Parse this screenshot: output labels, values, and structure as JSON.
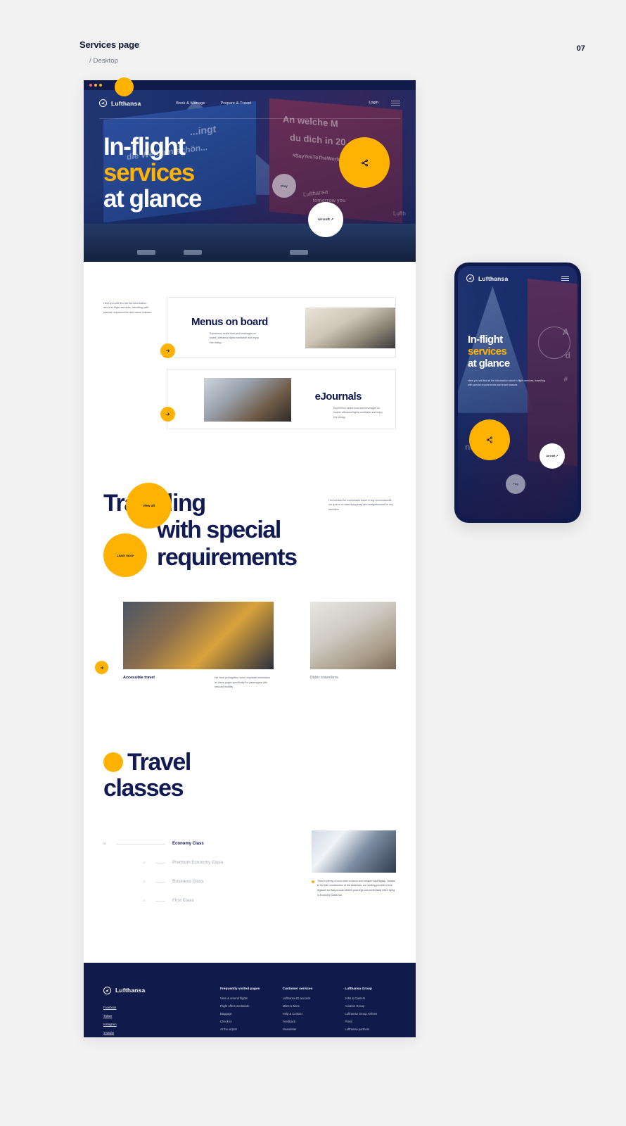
{
  "caption": {
    "title": "Services page",
    "subtitle": "/ Desktop",
    "page_number": "07"
  },
  "colors": {
    "navy": "#101a4b",
    "deep_navy": "#111a52",
    "amber": "#ffb300",
    "page_bg": "#f2f2f2"
  },
  "desktop": {
    "nav": {
      "brand": "Lufthansa",
      "links": [
        "Book & Manage",
        "Prepare & Travel"
      ],
      "login": "Login",
      "menu_icon": "hamburger-icon"
    },
    "hero": {
      "title_line1": "In-flight",
      "title_line2": "services",
      "title_line3": "at glance",
      "share_icon": "share-icon",
      "play_label": "Play",
      "aircraft_label": "Aircraft ↗",
      "billboard_text": {
        "line1": "...ingt",
        "line2": "die Welt am schön...",
        "line3": "An welche M",
        "line4": "du dich in 20",
        "hashtag": "#SayYesToTheWorld",
        "tomorrow": "tomorrow you",
        "brand1": "Lufthansa",
        "brand2": "Lufth"
      }
    },
    "services": {
      "intro": "Here you will find all the information about in-flight services, travelling with special requirements and travel classes.",
      "view_all": "View all",
      "cards": [
        {
          "title": "Menus on board",
          "description": "Experience select food and beverages on board Lufthansa flights worldwide and enjoy fine dining.",
          "arrow_icon": "arrow-right-icon"
        },
        {
          "title": "eJournals",
          "description": "Experience select food and beverages on board Lufthansa flights worldwide and enjoy fine dining.",
          "arrow_icon": "arrow-right-icon"
        }
      ]
    },
    "special": {
      "title_line1": "Travelling",
      "title_line2": "with special",
      "title_line3": "requirements",
      "description": "Our services for comfortable travel in any circumstances, our goal is to make flying easy and straightforward for any travellers.",
      "learn_more": "Learn more",
      "arrow_icon": "arrow-right-icon",
      "items": [
        {
          "name": "Accessible travel",
          "note": "We have put together some important information on these pages specifically for passengers with reduced mobility."
        },
        {
          "name": "Older travellers",
          "note": ""
        }
      ]
    },
    "classes": {
      "title_line1": "Travel",
      "title_line2": "classes",
      "items": [
        {
          "number": "01",
          "name": "Economy Class",
          "active": true
        },
        {
          "number": "02",
          "name": "Premium Economy Class",
          "active": false
        },
        {
          "number": "03",
          "name": "Business Class",
          "active": false
        },
        {
          "number": "04",
          "name": "First Class",
          "active": false
        }
      ],
      "panel_text": "There's plenty of room both on short and medium haul flights. Thanks to the slim construction of the backrests, our seating provides more legroom so that you can stretch your legs out comfortably when flying in Economy Class too."
    },
    "footer": {
      "brand": "Lufthansa",
      "social": [
        "Facebook",
        "Twitter",
        "Instagram",
        "Youtube"
      ],
      "columns": [
        {
          "heading": "Frequently visited pages",
          "links": [
            "View & amend flights",
            "Flight offers worldwide",
            "Baggage",
            "Check-in",
            "At the airport"
          ]
        },
        {
          "heading": "Customer services",
          "links": [
            "Lufthansa ID account",
            "Miles & More",
            "Help & Contact",
            "Feedback",
            "Newsletter"
          ]
        },
        {
          "heading": "Lufthansa Group",
          "links": [
            "Jobs & Careers",
            "Aviation Group",
            "Lufthansa Group Airlines",
            "Press",
            "Lufthansa partners"
          ]
        }
      ]
    }
  },
  "mobile": {
    "brand": "Lufthansa",
    "menu_icon": "hamburger-icon",
    "title_line1": "In-flight",
    "title_line2": "services",
    "title_line3": "at glance",
    "description": "Here you will find all the information about in-flight services, travelling with special requirements and travel classes.",
    "share_icon": "share-icon",
    "aircraft_label": "Aircraft ↗",
    "play_label": "Play",
    "bg_text": {
      "t1": "nsa",
      "t2": "A",
      "t3": "d",
      "t4": "#"
    }
  }
}
